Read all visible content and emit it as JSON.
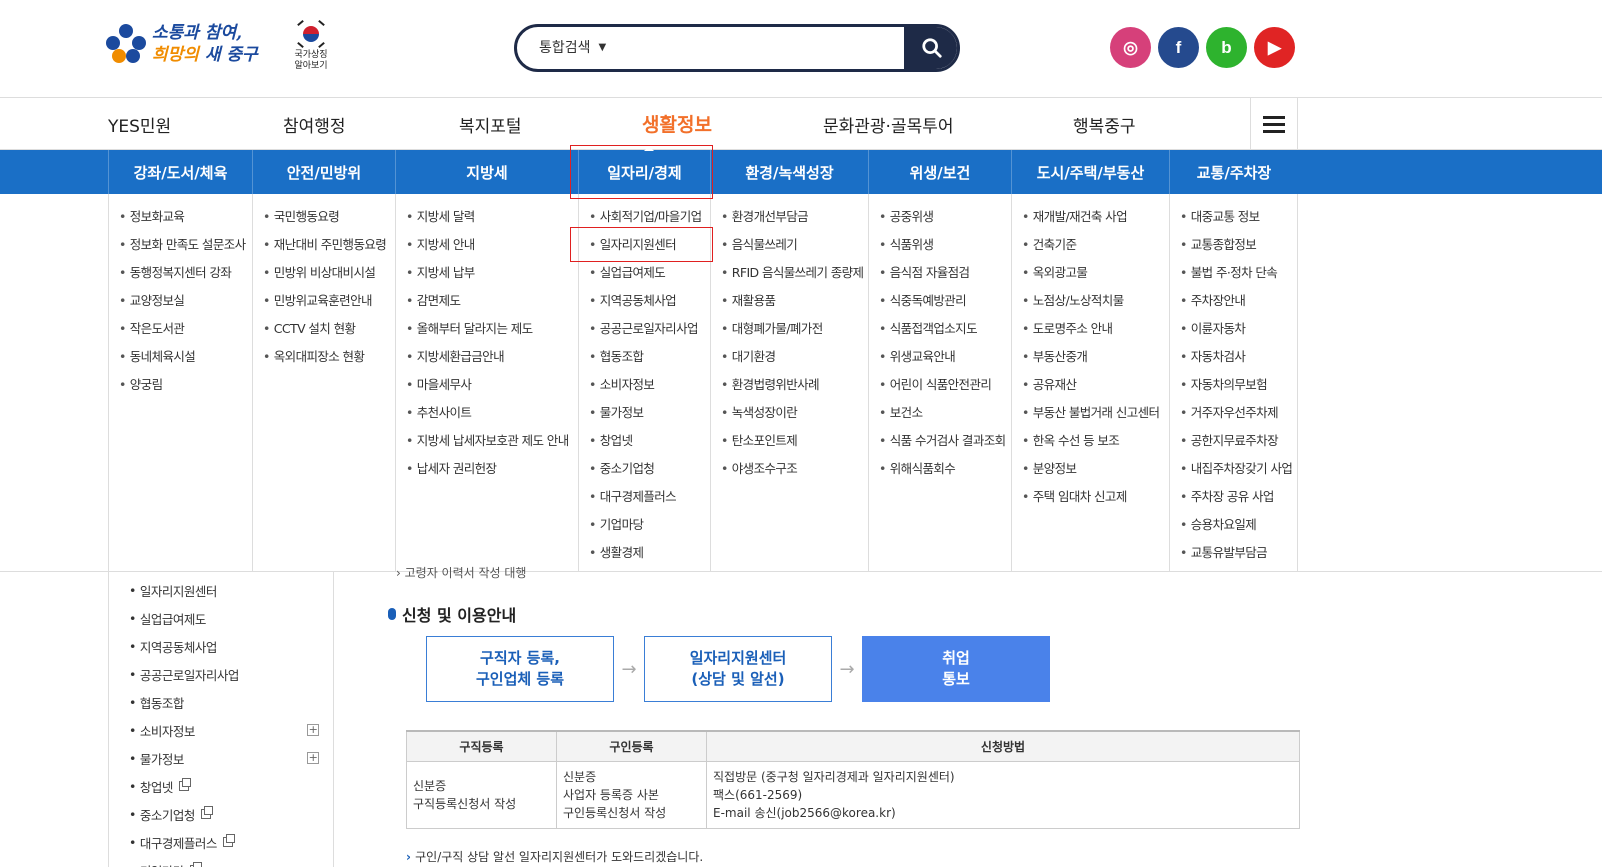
{
  "header": {
    "logo_line1": "소통과 참여,",
    "logo_line2_a": "희망의",
    "logo_line2_b": " 새 중구",
    "national_symbol": [
      "국가상징",
      "알아보기"
    ],
    "search": {
      "scope": "통합검색",
      "placeholder": ""
    },
    "socials": [
      {
        "name": "instagram",
        "glyph": "◎",
        "color": "#d6407a"
      },
      {
        "name": "facebook",
        "glyph": "f",
        "color": "#254a8e"
      },
      {
        "name": "blog",
        "glyph": "b",
        "color": "#2eb32e"
      },
      {
        "name": "youtube",
        "glyph": "▶",
        "color": "#e02424"
      }
    ]
  },
  "gnb": {
    "items": [
      "YES민원",
      "참여행정",
      "복지포털",
      "생활정보",
      "문화관광·골목투어",
      "행복중구"
    ],
    "active_index": 3,
    "accent_color": "#f2702a"
  },
  "mega_menu": {
    "bar_color": "#1a6fc6",
    "columns": [
      {
        "title": "강좌/도서/체육",
        "links": [
          "정보화교육",
          "정보화 만족도 설문조사",
          "동행정복지센터 강좌",
          "교양정보실",
          "작은도서관",
          "동네체육시설",
          "양궁림"
        ]
      },
      {
        "title": "안전/민방위",
        "links": [
          "국민행동요령",
          "재난대비 주민행동요령",
          "민방위 비상대비시설",
          "민방위교육훈련안내",
          "CCTV 설치 현황",
          "옥외대피장소 현황"
        ]
      },
      {
        "title": "지방세",
        "links": [
          "지방세 달력",
          "지방세 안내",
          "지방세 납부",
          "감면제도",
          "올해부터 달라지는 제도",
          "지방세환급금안내",
          "마을세무사",
          "추천사이트",
          "지방세 납세자보호관 제도 안내",
          "납세자 권리헌장"
        ]
      },
      {
        "title": "일자리/경제",
        "links": [
          "사회적기업/마을기업",
          "일자리지원센터",
          "실업급여제도",
          "지역공동체사업",
          "공공근로일자리사업",
          "협동조합",
          "소비자정보",
          "물가정보",
          "창업넷",
          "중소기업청",
          "대구경제플러스",
          "기업마당",
          "생활경제"
        ]
      },
      {
        "title": "환경/녹색성장",
        "links": [
          "환경개선부담금",
          "음식물쓰레기",
          "RFID 음식물쓰레기 종량제",
          "재활용품",
          "대형폐가물/폐가전",
          "대기환경",
          "환경법령위반사례",
          "녹색성장이란",
          "탄소포인트제",
          "야생조수구조"
        ]
      },
      {
        "title": "위생/보건",
        "links": [
          "공중위생",
          "식품위생",
          "음식점 자율점검",
          "식중독예방관리",
          "식품접객업소지도",
          "위생교육안내",
          "어린이 식품안전관리",
          "보건소",
          "식품 수거검사 결과조회",
          "위해식품회수"
        ]
      },
      {
        "title": "도시/주택/부동산",
        "links": [
          "재개발/재건축 사업",
          "건축기준",
          "옥외광고물",
          "노점상/노상적치물",
          "도로명주소 안내",
          "부동산중개",
          "공유재산",
          "부동산 불법거래 신고센터",
          "한옥 수선 등 보조",
          "분양정보",
          "주택 임대차 신고제"
        ]
      },
      {
        "title": "교통/주차장",
        "links": [
          "대중교통 정보",
          "교통종합정보",
          "불법 주·정차 단속",
          "주차장안내",
          "이륜자동차",
          "자동차검사",
          "자동차의무보험",
          "거주자우선주차제",
          "공한지무료주차장",
          "내집주차장갖기 사업",
          "주차장 공유 사업",
          "승용차요일제",
          "교통유발부담금"
        ]
      }
    ]
  },
  "left_nav": {
    "items": [
      {
        "label": "일자리지원센터",
        "expand": false,
        "external": false
      },
      {
        "label": "실업급여제도",
        "expand": false,
        "external": false
      },
      {
        "label": "지역공동체사업",
        "expand": false,
        "external": false
      },
      {
        "label": "공공근로일자리사업",
        "expand": false,
        "external": false
      },
      {
        "label": "협동조합",
        "expand": false,
        "external": false
      },
      {
        "label": "소비자정보",
        "expand": true,
        "external": false
      },
      {
        "label": "물가정보",
        "expand": true,
        "external": false
      },
      {
        "label": "창업넷",
        "expand": false,
        "external": true
      },
      {
        "label": "중소기업청",
        "expand": false,
        "external": true
      },
      {
        "label": "대구경제플러스",
        "expand": false,
        "external": true
      },
      {
        "label": "기업마당",
        "expand": false,
        "external": true
      }
    ]
  },
  "main": {
    "cut_text": "› 고령자 이력서 작성 대행",
    "section_title": "신청 및 이용안내",
    "steps": [
      "구직자 등록,\n구인업체 등록",
      "일자리지원센터\n(상담 및 알선)",
      "취업\n통보"
    ],
    "table": {
      "headers": [
        "구직등록",
        "구인등록",
        "신청방법"
      ],
      "row": [
        "신분증\n구직등록신청서 작성",
        "신분증\n사업자 등록증 사본\n구인등록신청서 작성",
        "직접방문 (중구청 일자리경제과 일자리지원센터)\n팩스(661-2569)\nE-mail 송신(job2566@korea.kr)"
      ]
    },
    "note": "구인/구직 상담 알선 일자리지원센터가 도와드리겠습니다."
  }
}
